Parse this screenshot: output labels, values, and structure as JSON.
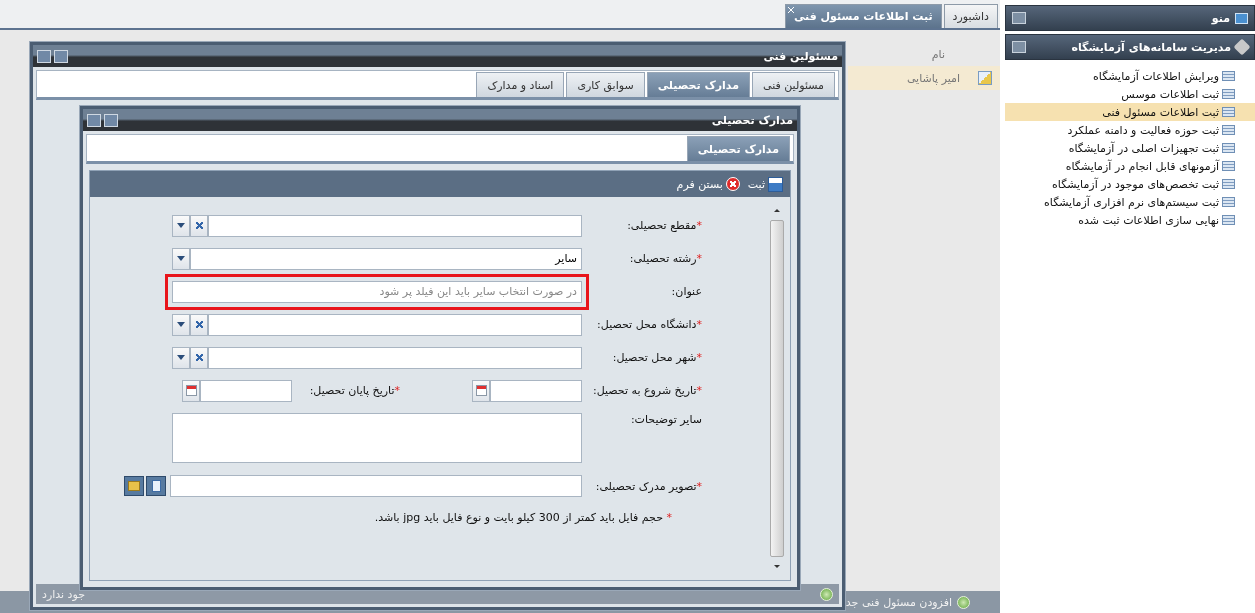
{
  "menu": {
    "title": "منو",
    "group": {
      "title": "مدیریت سامانه‌های آزمایشگاه",
      "items": [
        {
          "label": "ویرایش اطلاعات آزمایشگاه",
          "selected": false
        },
        {
          "label": "ثبت اطلاعات موسس",
          "selected": false
        },
        {
          "label": "ثبت اطلاعات مسئول فنی",
          "selected": true
        },
        {
          "label": "ثبت حوزه فعالیت و دامنه عملکرد",
          "selected": false
        },
        {
          "label": "ثبت تجهیزات اصلی در آزمایشگاه",
          "selected": false
        },
        {
          "label": "آزمونهای قابل انجام در آزمایشگاه",
          "selected": false
        },
        {
          "label": "ثبت تخصص‌های موجود در آزمایشگاه",
          "selected": false
        },
        {
          "label": "ثبت سیستم‌های نرم افزاری آزمایشگاه",
          "selected": false
        },
        {
          "label": "نهایی سازی اطلاعات ثبت شده",
          "selected": false
        }
      ]
    }
  },
  "tabs": [
    {
      "label": "داشبورد",
      "selected": false,
      "closable": false
    },
    {
      "label": "ثبت اطلاعات مسئول فنی",
      "selected": true,
      "closable": true
    }
  ],
  "grid": {
    "columns": [
      "نام"
    ],
    "rows": [
      {
        "cells": [
          "امیر پاشایی"
        ],
        "selected": true
      }
    ],
    "add_label": "افزودن مسئول فنی جد"
  },
  "window": {
    "title": "مسئولین فنی",
    "tabs": [
      {
        "label": "مسئولین فنی",
        "selected": false
      },
      {
        "label": "مدارک تحصیلی",
        "selected": true
      },
      {
        "label": "سوابق کاری",
        "selected": false
      },
      {
        "label": "اسناد و مدارک",
        "selected": false
      }
    ],
    "footer_text": "جود ندارد"
  },
  "dialog": {
    "title": "مدارک تحصیلی",
    "tabs": [
      {
        "label": "مدارک تحصیلی",
        "selected": true
      }
    ],
    "toolbar": [
      {
        "kind": "save",
        "label": "ثبت"
      },
      {
        "kind": "close",
        "label": "بستن فرم"
      }
    ],
    "fields": [
      {
        "kind": "combo",
        "label": "مقطع تحصیلی:",
        "required_mark": "*",
        "clearable": true
      },
      {
        "kind": "combo",
        "label": "رشته تحصیلی:",
        "required_mark": "*",
        "clearable": false,
        "value": "سایر"
      },
      {
        "kind": "text",
        "label": "عنوان:",
        "placeholder": "در صورت انتخاب سایر باید این فیلد پر شود",
        "highlighted": true
      },
      {
        "kind": "combo",
        "label": "دانشگاه محل تحصیل:",
        "required_mark": "*",
        "clearable": true
      },
      {
        "kind": "combo",
        "label": "شهر محل تحصیل:",
        "required_mark": "*",
        "clearable": true
      },
      {
        "kind": "dates",
        "parts": [
          {
            "label": "تاریخ شروع به تحصیل:",
            "required_mark": "*"
          },
          {
            "label": "تاریخ پایان تحصیل:",
            "required_mark": "*"
          }
        ]
      },
      {
        "kind": "textarea",
        "label": "سایر توضیحات:"
      },
      {
        "kind": "file",
        "label": "تصویر مدرک تحصیلی:",
        "required_mark": "*"
      }
    ],
    "note_mark": "*",
    "note": "حجم فایل باید کمتر از 300 کیلو بایت و نوع فایل باید jpg باشد."
  }
}
